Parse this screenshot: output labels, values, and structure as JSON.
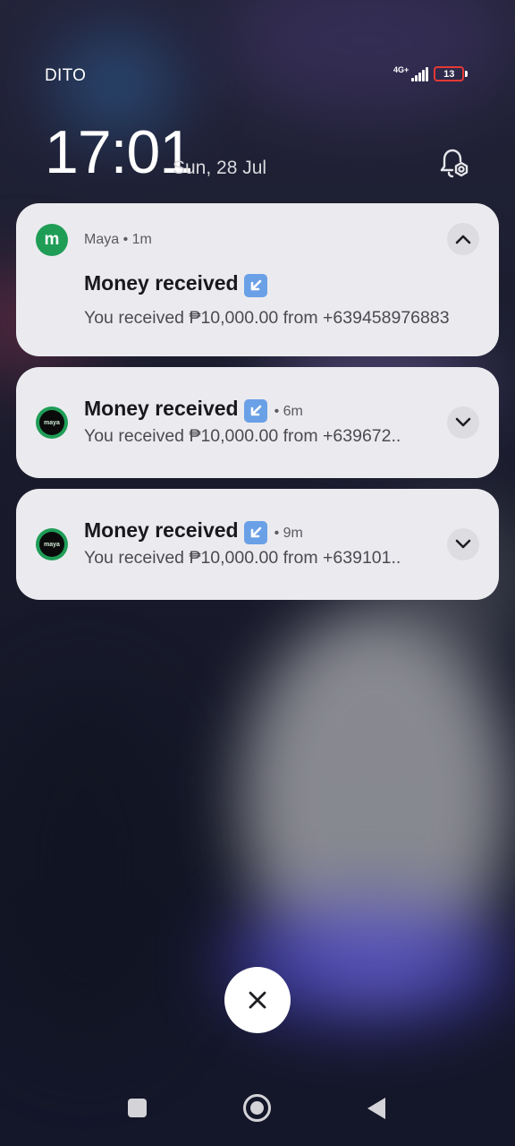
{
  "status_bar": {
    "carrier": "DITO",
    "network": "4G+",
    "battery": "13"
  },
  "lockscreen": {
    "time": "17:01",
    "date": "Sun, 28 Jul"
  },
  "notifications": [
    {
      "app": "Maya",
      "age": "1m",
      "app_meta": "Maya • 1m",
      "title": "Money received",
      "body": "You received ₱10,000.00 from +639458976883",
      "expanded": true
    },
    {
      "age_label": "• 6m",
      "title": "Money received",
      "body": "You received ₱10,000.00 from +639672..",
      "expanded": false
    },
    {
      "age_label": "• 9m",
      "title": "Money received",
      "body": "You received ₱10,000.00 from +639101..",
      "expanded": false
    }
  ],
  "icons": {
    "app_icon": "maya-icon",
    "app_icon_letter": "m",
    "maya_logo_text": "maya",
    "expand_icon": "chevron-up-icon",
    "collapse_icon": "chevron-down-icon",
    "emoji": "arrow-down-left-icon",
    "clear_all": "close-icon",
    "settings": "notification-settings-icon"
  },
  "colors": {
    "maya_green": "#1f9d57",
    "card_bg": "#ebebef",
    "emoji_blue": "#6aa0e6",
    "battery_low": "#e53935"
  }
}
